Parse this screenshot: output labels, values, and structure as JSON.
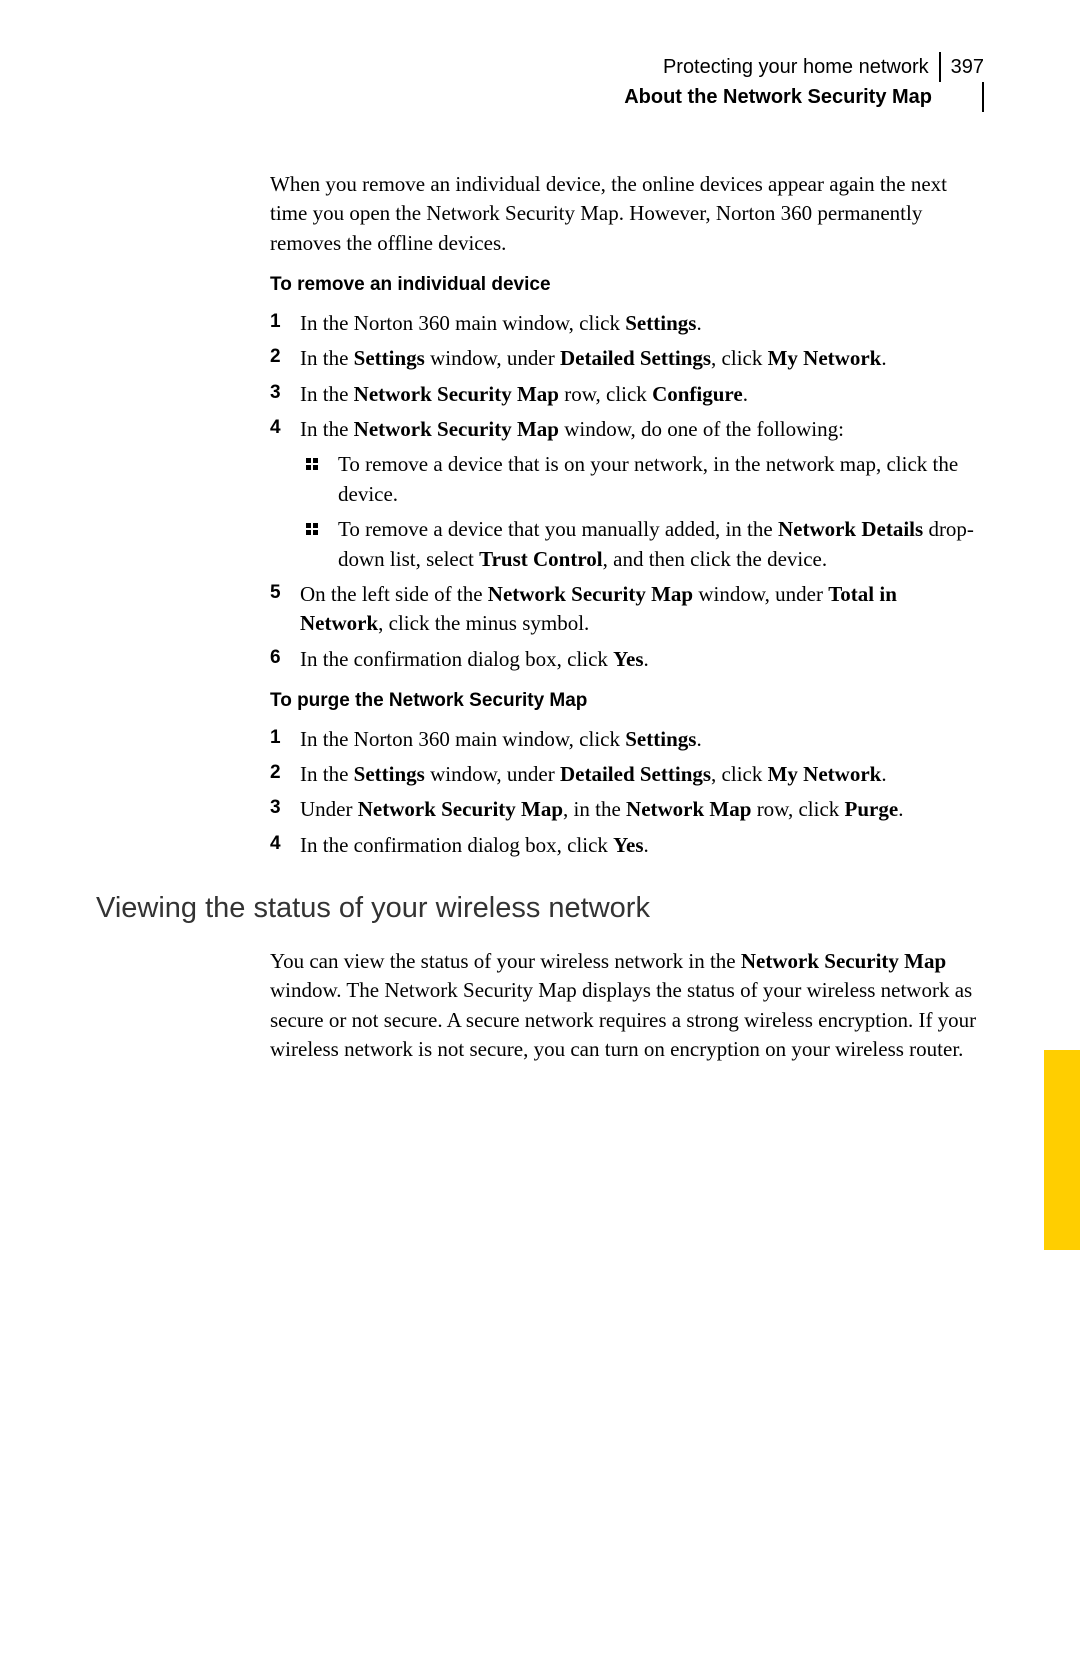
{
  "header": {
    "chapter": "Protecting your home network",
    "page": "397",
    "section": "About the Network Security Map"
  },
  "intro": "When you remove an individual device, the online devices appear again the next time you open the Network Security Map. However, Norton 360 permanently removes the offline devices.",
  "proc1": {
    "title": "To remove an individual device",
    "s1_a": "In the Norton 360 main window, click ",
    "s1_b": "Settings",
    "s1_c": ".",
    "s2_a": "In the ",
    "s2_b": "Settings",
    "s2_c": " window, under ",
    "s2_d": "Detailed Settings",
    "s2_e": ", click ",
    "s2_f": "My Network",
    "s2_g": ".",
    "s3_a": "In the ",
    "s3_b": "Network Security Map",
    "s3_c": " row, click ",
    "s3_d": "Configure",
    "s3_e": ".",
    "s4_a": "In the ",
    "s4_b": "Network Security Map",
    "s4_c": " window, do one of the following:",
    "s4_bul1": "To remove a device that is on your network, in the network map, click the device.",
    "s4_bul2_a": "To remove a device that you manually added, in the ",
    "s4_bul2_b": "Network Details",
    "s4_bul2_c": " drop-down list, select ",
    "s4_bul2_d": "Trust Control",
    "s4_bul2_e": ", and then click the device.",
    "s5_a": "On the left side of the ",
    "s5_b": "Network Security Map",
    "s5_c": " window, under ",
    "s5_d": "Total in Network",
    "s5_e": ", click the minus symbol.",
    "s6_a": "In the confirmation dialog box, click ",
    "s6_b": "Yes",
    "s6_c": "."
  },
  "proc2": {
    "title": "To purge the Network Security Map",
    "s1_a": "In the Norton 360 main window, click ",
    "s1_b": "Settings",
    "s1_c": ".",
    "s2_a": "In the ",
    "s2_b": "Settings",
    "s2_c": " window, under ",
    "s2_d": "Detailed Settings",
    "s2_e": ", click ",
    "s2_f": "My Network",
    "s2_g": ".",
    "s3_a": "Under ",
    "s3_b": "Network Security Map",
    "s3_c": ", in the ",
    "s3_d": "Network Map",
    "s3_e": " row, click ",
    "s3_f": "Purge",
    "s3_g": ".",
    "s4_a": "In the confirmation dialog box, click ",
    "s4_b": "Yes",
    "s4_c": "."
  },
  "heading2": "Viewing the status of your wireless network",
  "para2_a": "You can view the status of your wireless network in the ",
  "para2_b": "Network Security Map",
  "para2_c": " window. The Network Security Map displays the status of your wireless network as secure or not secure. A secure network requires a strong wireless encryption. If your wireless network is not secure, you can turn on encryption on your wireless router."
}
